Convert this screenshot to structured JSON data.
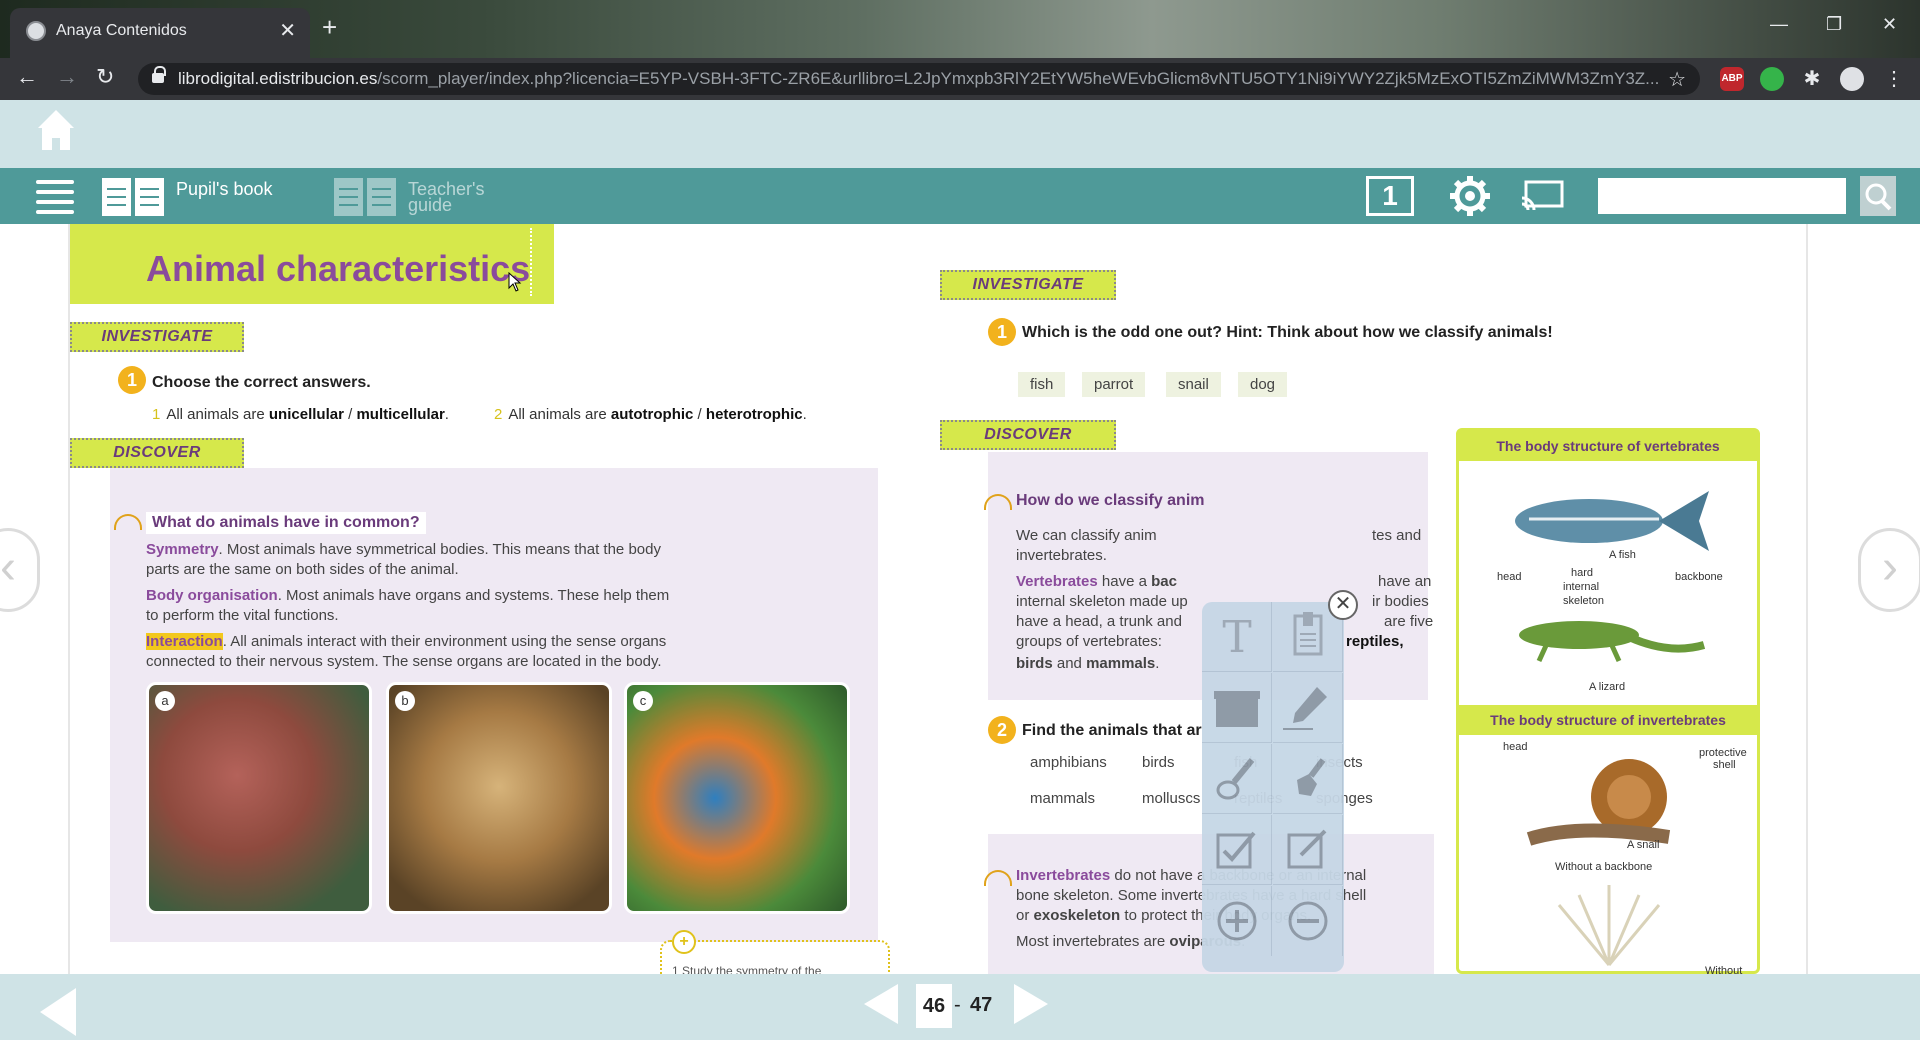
{
  "browser": {
    "tab_title": "Anaya Contenidos",
    "tab_close": "✕",
    "new_tab": "+",
    "url_host": "librodigital.edistribucion.es",
    "url_path": "/scorm_player/index.php?licencia=E5YP-VSBH-3FTC-ZR6E&urllibro=L2JpYmxpb3RlY2EtYW5heWEvbGlicm8vNTU5OTY1Ni9iYWY2Zjk5MzExOTI5ZmZiMWM3ZmY3Z...",
    "ext_abp": "ABP",
    "minimize": "—",
    "restore": "❐",
    "close": "✕"
  },
  "toolbar": {
    "pupils_book": "Pupil's book",
    "teachers_guide_l1": "Teacher's",
    "teachers_guide_l2": "guide",
    "page_mode": "1"
  },
  "left_page": {
    "title": "Animal characteristics",
    "investigate_tag": "INVESTIGATE",
    "q1_num": "1",
    "q1_text": "Choose the correct answers.",
    "q1_a_num": "1",
    "q1_a_pre": "All animals are ",
    "q1_a_opt1": "unicellular",
    "q1_a_sep": " / ",
    "q1_a_opt2": "multicellular",
    "q1_a_end": ".",
    "q1_b_num": "2",
    "q1_b_pre": "All animals are ",
    "q1_b_opt1": "autotrophic",
    "q1_b_sep": " / ",
    "q1_b_opt2": "heterotrophic",
    "q1_b_end": ".",
    "discover_tag": "DISCOVER",
    "common_title": "What do animals have in common?",
    "sym_kw": "Symmetry",
    "sym_text": ". Most animals have symmetrical bodies. This means that the body",
    "sym_text2": "parts are the same on both sides of the animal.",
    "body_kw": "Body organisation",
    "body_text": ". Most animals have organs and systems. These help them",
    "body_text2": "to perform the vital functions.",
    "inter_kw": "Interaction",
    "inter_text": ". All animals interact with their environment using the sense organs",
    "inter_text2": "connected to their nervous system. The sense organs are located in the body.",
    "photo_a": "a",
    "photo_b": "b",
    "photo_c": "c",
    "bottom_hint": "1  Study the symmetry of the"
  },
  "right_page": {
    "investigate_tag": "INVESTIGATE",
    "q1_num": "1",
    "q1_text": "Which is the odd one out? Hint: Think about how we classify animals!",
    "odd_words": [
      "fish",
      "parrot",
      "snail",
      "dog"
    ],
    "discover_tag": "DISCOVER",
    "classify_title": "How do we classify anim",
    "p1a": "We can classify anim",
    "p1b": "tes and",
    "p1c": "invertebrates.",
    "vert_kw": "Vertebrates",
    "p2a": " have a ",
    "p2a_bold": "bac",
    "p2b": "have an",
    "p2c": "internal skeleton made up",
    "p2d": "ir bodies",
    "p2e": "have a head, a trunk and",
    "p2f": "are five",
    "p2g": "groups of vertebrates:",
    "p2h": "reptiles,",
    "p2i": "birds",
    "p2j": " and ",
    "p2k": "mammals",
    "p2l": ".",
    "q2_num": "2",
    "q2_text": "Find the animals that ar",
    "animals_row1": [
      "amphibians",
      "birds",
      "fish",
      "insects"
    ],
    "animals_row2": [
      "mammals",
      "molluscs",
      "reptiles",
      "sponges"
    ],
    "invert_kw": "Invertebrates",
    "invert_text": " do not have a backbone or an internal",
    "invert_text2": "bone skeleton. Some invertebrates have a hard shell",
    "invert_text3a": "or ",
    "invert_text3b": "exoskeleton",
    "invert_text3c": " to protect their body organs.",
    "ovip_a": "Most invertebrates are ",
    "ovip_b": "oviparous",
    "ovip_c": ".",
    "vert_box_title": "The body structure of vertebrates",
    "label_fish": "A fish",
    "label_head": "head",
    "label_hard": "hard",
    "label_internal": "internal",
    "label_skeleton": "skeleton",
    "label_backbone": "backbone",
    "label_lizard": "A lizard",
    "invert_box_title": "The body structure of invertebrates",
    "label_head2": "head",
    "label_protective": "protective",
    "label_shell": "shell",
    "label_snail": "A snail",
    "label_without": "Without a backbone",
    "label_without2": "Without"
  },
  "palette": {
    "close": "✕",
    "tools": [
      "text-tool-icon",
      "note-tool-icon",
      "mask-tool-icon",
      "pen-tool-icon",
      "brush-tool-icon",
      "eraser-tool-icon",
      "check-tool-icon",
      "edit-tool-icon",
      "zoom-in-icon",
      "zoom-out-icon"
    ]
  },
  "footer": {
    "left_page_num": "46",
    "separator": "-",
    "right_page_num": "47"
  },
  "colors": {
    "teal": "#4f9a99",
    "lime": "#d6e84b",
    "purple": "#8a4b9c",
    "orange": "#f2b21d"
  }
}
